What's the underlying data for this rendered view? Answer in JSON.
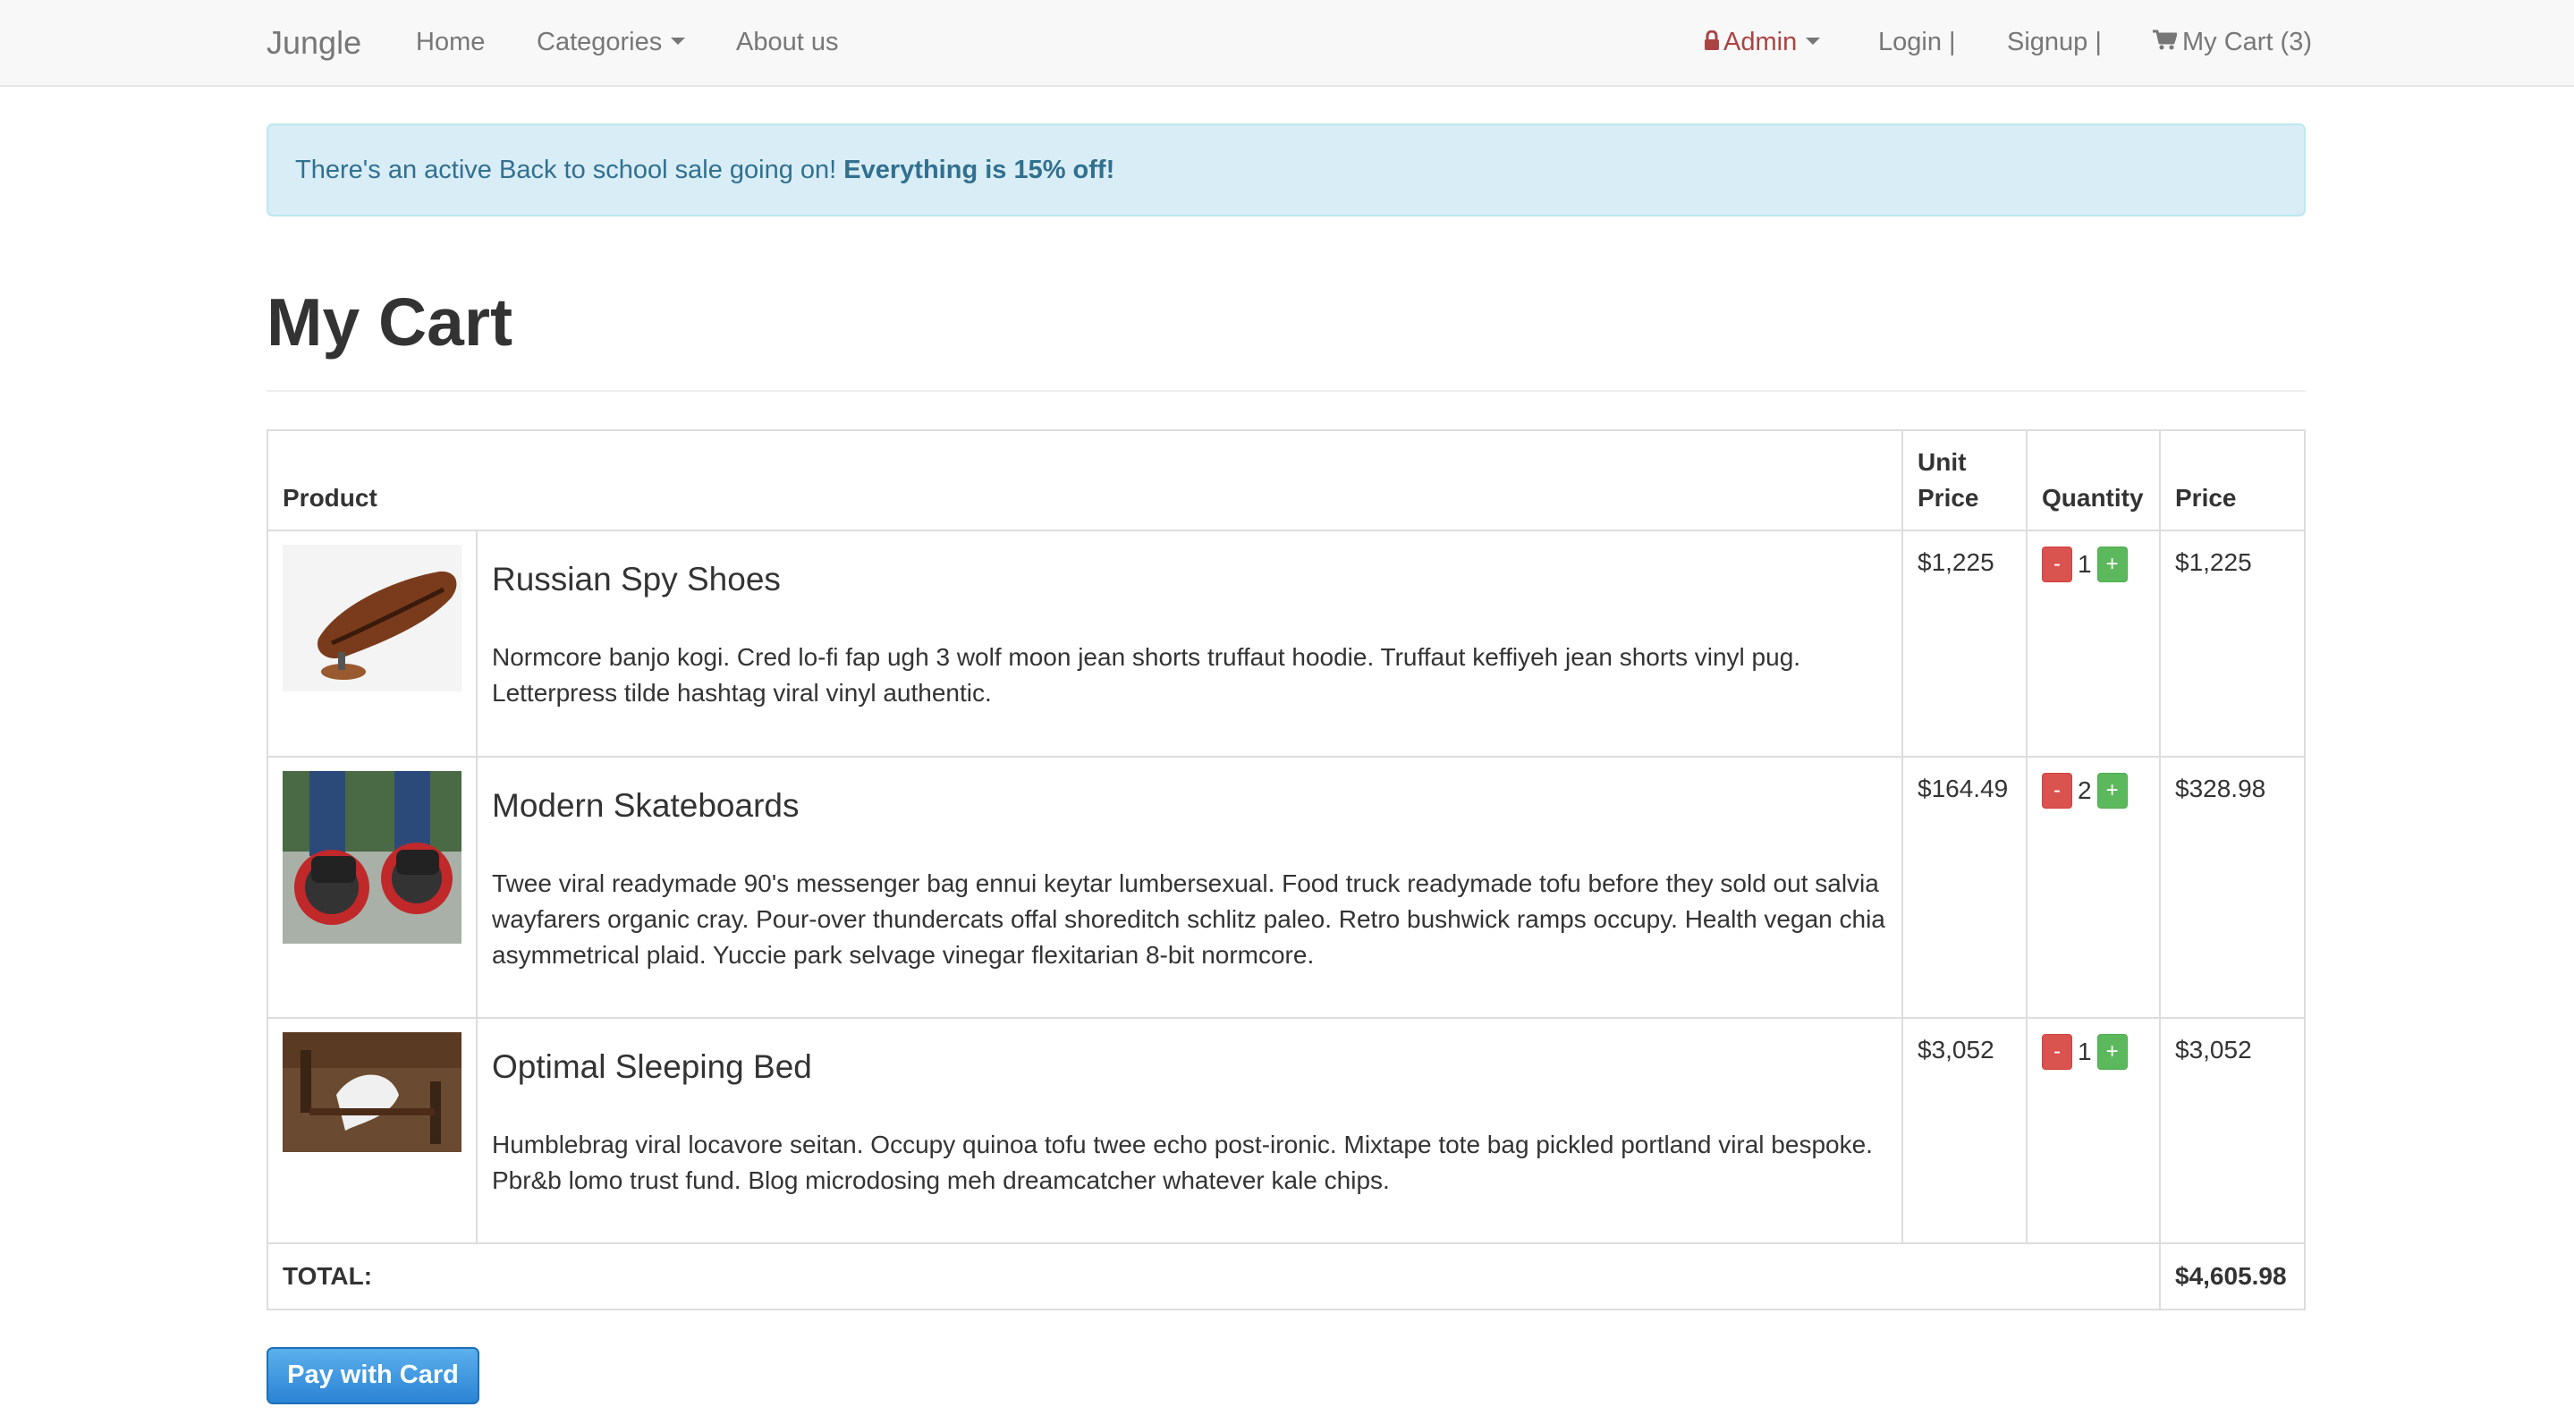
{
  "navbar": {
    "brand": "Jungle",
    "home": "Home",
    "categories": "Categories",
    "about": "About us",
    "admin": "Admin",
    "login": "Login |",
    "signup": "Signup |",
    "cart": "My Cart (3)"
  },
  "alert": {
    "text": "There's an active Back to school sale going on! ",
    "bold": "Everything is 15% off!"
  },
  "page": {
    "title": "My Cart"
  },
  "table": {
    "headers": {
      "product": "Product",
      "unit_price": "Unit Price",
      "quantity": "Quantity",
      "price": "Price"
    },
    "rows": [
      {
        "name": "Russian Spy Shoes",
        "description": "Normcore banjo kogi. Cred lo-fi fap ugh 3 wolf moon jean shorts truffaut hoodie. Truffaut keffiyeh jean shorts vinyl pug. Letterpress tilde hashtag viral vinyl authentic.",
        "unit_price": "$1,225",
        "quantity": "1",
        "price": "$1,225"
      },
      {
        "name": "Modern Skateboards",
        "description": "Twee viral readymade 90's messenger bag ennui keytar lumbersexual. Food truck readymade tofu before they sold out salvia wayfarers organic cray. Pour-over thundercats offal shoreditch schlitz paleo. Retro bushwick ramps occupy. Health vegan chia asymmetrical plaid. Yuccie park selvage vinegar flexitarian 8-bit normcore.",
        "unit_price": "$164.49",
        "quantity": "2",
        "price": "$328.98"
      },
      {
        "name": "Optimal Sleeping Bed",
        "description": "Humblebrag viral locavore seitan. Occupy quinoa tofu twee echo post-ironic. Mixtape tote bag pickled portland viral bespoke. Pbr&b lomo trust fund. Blog microdosing meh dreamcatcher whatever kale chips.",
        "unit_price": "$3,052",
        "quantity": "1",
        "price": "$3,052"
      }
    ],
    "minus_label": "-",
    "plus_label": "+",
    "total_label": "TOTAL:",
    "total_value": "$4,605.98"
  },
  "pay_button": "Pay with Card",
  "colors": {
    "alert_bg": "#d9edf7",
    "alert_text": "#31708f",
    "admin": "#a94442",
    "minus_btn": "#d9534f",
    "plus_btn": "#5cb85c",
    "pay_btn": "#337ab7"
  }
}
